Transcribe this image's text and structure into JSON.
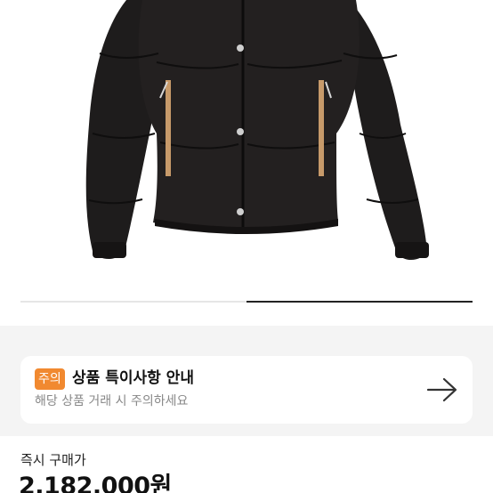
{
  "product": {
    "image_description_icon": "black-down-puffer-jacket-image",
    "image_slider_progress": 0.5
  },
  "notice": {
    "badge": "주의",
    "title": "상품 특이사항 안내",
    "subtitle": "해당 상품 거래 시 주의하세요",
    "arrow_icon": "arrow-right-icon",
    "badge_color": "#f18930"
  },
  "price": {
    "label": "즉시 구매가",
    "value": "2,182,000원"
  }
}
